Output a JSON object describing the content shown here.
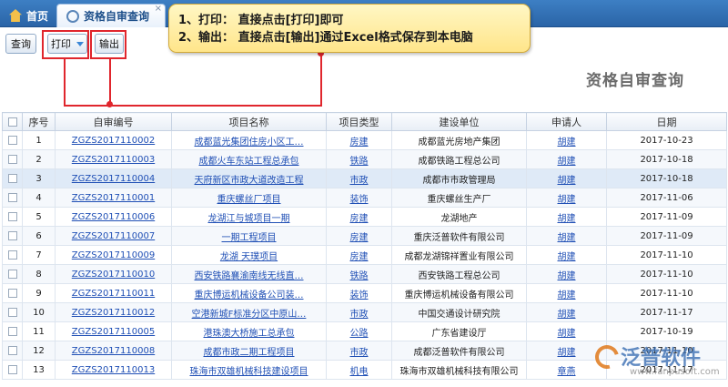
{
  "tabs": {
    "home": "首页",
    "active": "资格自审查询",
    "close": "×"
  },
  "toolbar": {
    "query": "查询",
    "print": "打印",
    "export": "输出"
  },
  "callout": {
    "line1": "1、打印：  直接点击[打印]即可",
    "line2": "2、输出：  直接点击[输出]通过Excel格式保存到本电脑"
  },
  "page_title": "资格自审查询",
  "table": {
    "headers": [
      "序号",
      "自审编号",
      "项目名称",
      "项目类型",
      "建设单位",
      "申请人",
      "日期"
    ],
    "rows": [
      [
        "1",
        "ZGZS2017110002",
        "成都蓝光集团住房小区工…",
        "房建",
        "成都蓝光房地产集团",
        "胡建",
        "2017-10-23"
      ],
      [
        "2",
        "ZGZS2017110003",
        "成都火车东站工程总承包",
        "铁路",
        "成都铁路工程总公司",
        "胡建",
        "2017-10-18"
      ],
      [
        "3",
        "ZGZS2017110004",
        "天府新区市政大道改造工程",
        "市政",
        "成都市市政管理局",
        "胡建",
        "2017-10-18"
      ],
      [
        "4",
        "ZGZS2017110001",
        "重庆螺丝厂项目",
        "装饰",
        "重庆螺丝生产厂",
        "胡建",
        "2017-11-06"
      ],
      [
        "5",
        "ZGZS2017110006",
        "龙湖江与城项目一期",
        "房建",
        "龙湖地产",
        "胡建",
        "2017-11-09"
      ],
      [
        "6",
        "ZGZS2017110007",
        "一期工程项目",
        "房建",
        "重庆泛普软件有限公司",
        "胡建",
        "2017-11-09"
      ],
      [
        "7",
        "ZGZS2017110009",
        "龙湖 天璞项目",
        "房建",
        "成都龙湖锦祥置业有限公司",
        "胡建",
        "2017-11-10"
      ],
      [
        "8",
        "ZGZS2017110010",
        "西安铁路襄渝南线无线直…",
        "铁路",
        "西安铁路工程总公司",
        "胡建",
        "2017-11-10"
      ],
      [
        "9",
        "ZGZS2017110011",
        "重庆博运机械设备公司装…",
        "装饰",
        "重庆博运机械设备有限公司",
        "胡建",
        "2017-11-10"
      ],
      [
        "10",
        "ZGZS2017110012",
        "空港新城F标准分区中原山…",
        "市政",
        "中国交通设计研究院",
        "胡建",
        "2017-11-17"
      ],
      [
        "11",
        "ZGZS2017110005",
        "港珠澳大桥施工总承包",
        "公路",
        "广东省建设厅",
        "胡建",
        "2017-10-19"
      ],
      [
        "12",
        "ZGZS2017110008",
        "成都市政二期工程项目",
        "市政",
        "成都泛普软件有限公司",
        "胡建",
        "2017-11-10"
      ],
      [
        "13",
        "ZGZS2017110013",
        "珠海市双雄机械科技建设项目",
        "机电",
        "珠海市双雄机械科技有限公司",
        "章燕",
        "2017-11-17"
      ]
    ]
  },
  "watermark": {
    "brand": "泛普软件",
    "url": "www.fanpusoft.com"
  },
  "colors": {
    "tab_blue": "#2a64a7",
    "highlight_red": "#e0262d",
    "callout_yellow": "#ffe58a",
    "link_blue": "#1f4fb5"
  }
}
